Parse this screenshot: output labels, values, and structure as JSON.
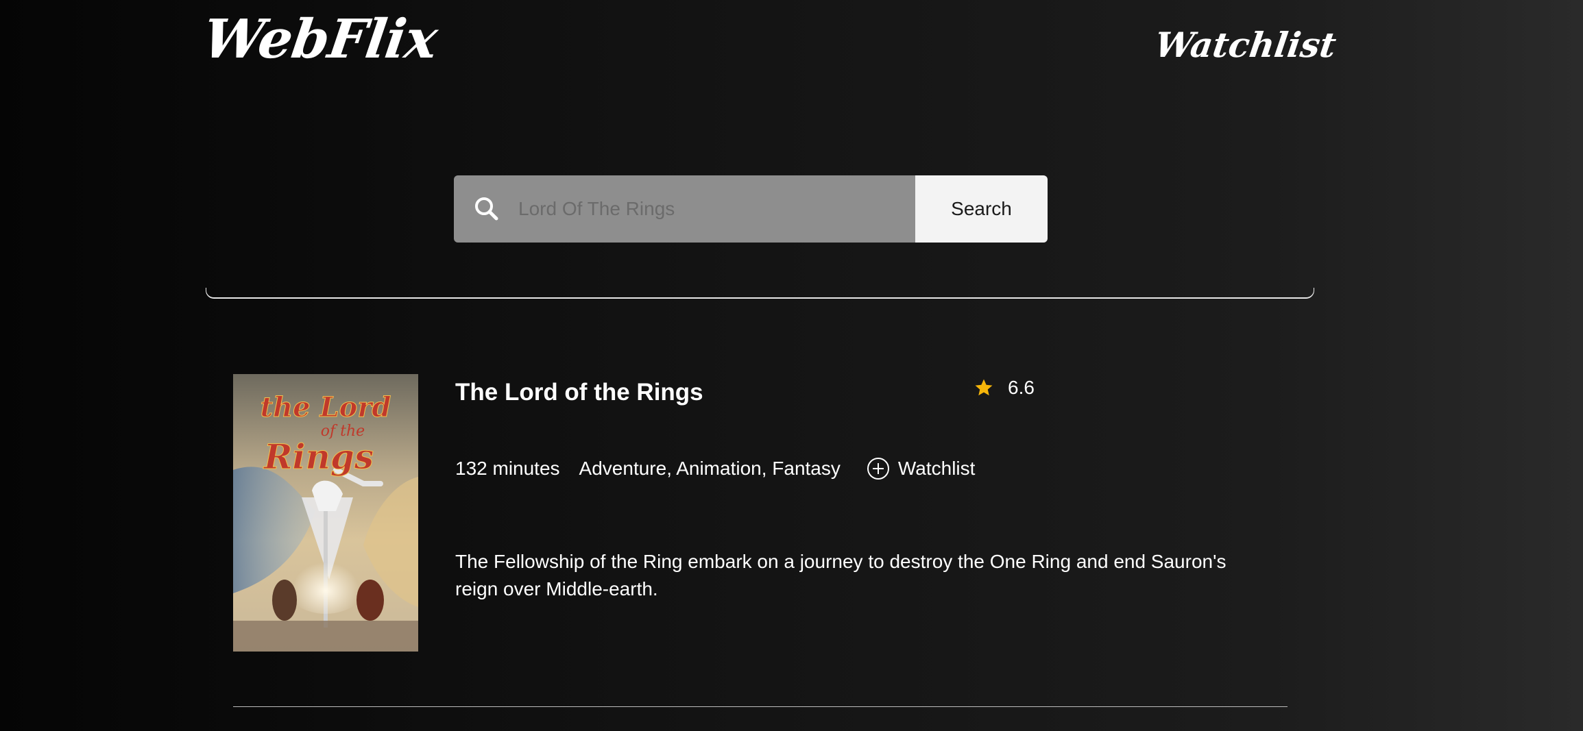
{
  "header": {
    "logo": "WebFlix",
    "nav_watchlist": "Watchlist"
  },
  "search": {
    "placeholder": "Lord Of The Rings",
    "value": "",
    "button_label": "Search",
    "icon": "search-icon"
  },
  "results": [
    {
      "title": "The Lord of the Rings",
      "rating": "6.6",
      "rating_icon": "star-icon",
      "runtime": "132 minutes",
      "genres": "Adventure, Animation, Fantasy",
      "watchlist_label": "Watchlist",
      "watchlist_icon": "plus-circle-icon",
      "plot": "The Fellowship of the Ring embark on a journey to destroy the One Ring and end Sauron's reign over Middle-earth.",
      "poster": {
        "title_line1": "the Lord",
        "title_line2": "of the",
        "title_line3": "Rings"
      }
    }
  ],
  "colors": {
    "accent_star": "#f5b50a",
    "search_field_bg": "#8e8e8e",
    "search_button_bg": "#f3f3f3",
    "poster_title": "#c0392b"
  }
}
